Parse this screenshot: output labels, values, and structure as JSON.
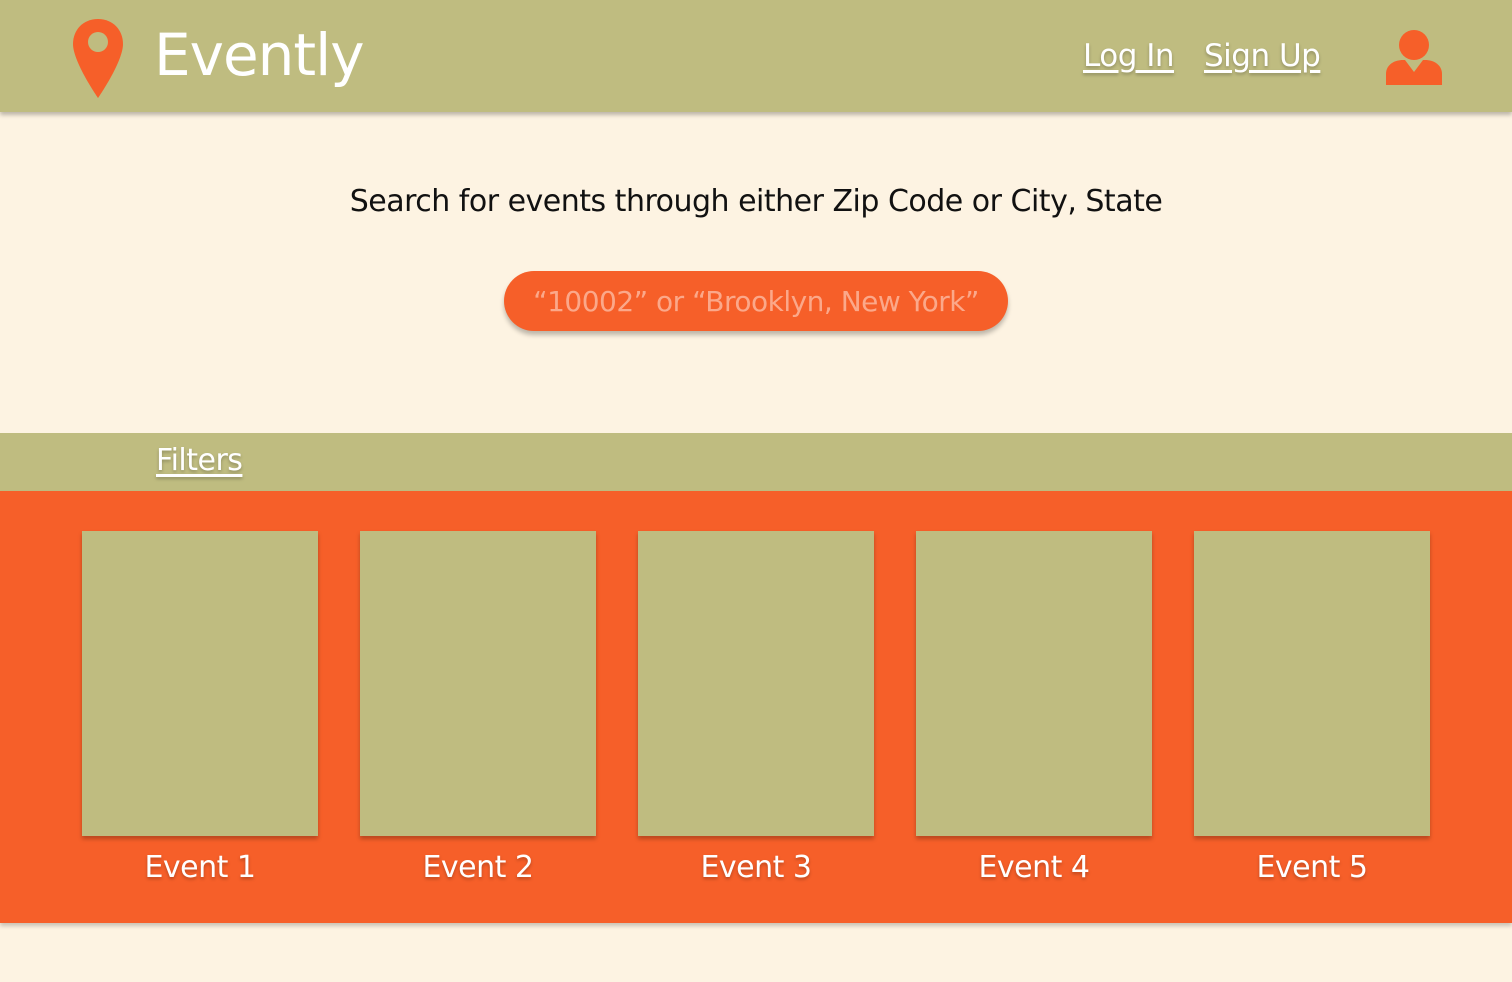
{
  "colors": {
    "olive": "#BFBC80",
    "orange": "#F65F29",
    "cream": "#FDF3E2",
    "white": "#FFFFFF"
  },
  "header": {
    "brand": "Evently",
    "logo_icon": "map-pin-icon",
    "login_label": "Log In",
    "signup_label": "Sign Up",
    "user_icon": "user-icon"
  },
  "search": {
    "prompt": "Search for events through either Zip Code or City, State",
    "placeholder": "“10002” or “Brooklyn, New York”",
    "value": ""
  },
  "filters": {
    "label": "Filters"
  },
  "events": [
    {
      "label": "Event 1"
    },
    {
      "label": "Event 2"
    },
    {
      "label": "Event 3"
    },
    {
      "label": "Event 4"
    },
    {
      "label": "Event 5"
    }
  ]
}
